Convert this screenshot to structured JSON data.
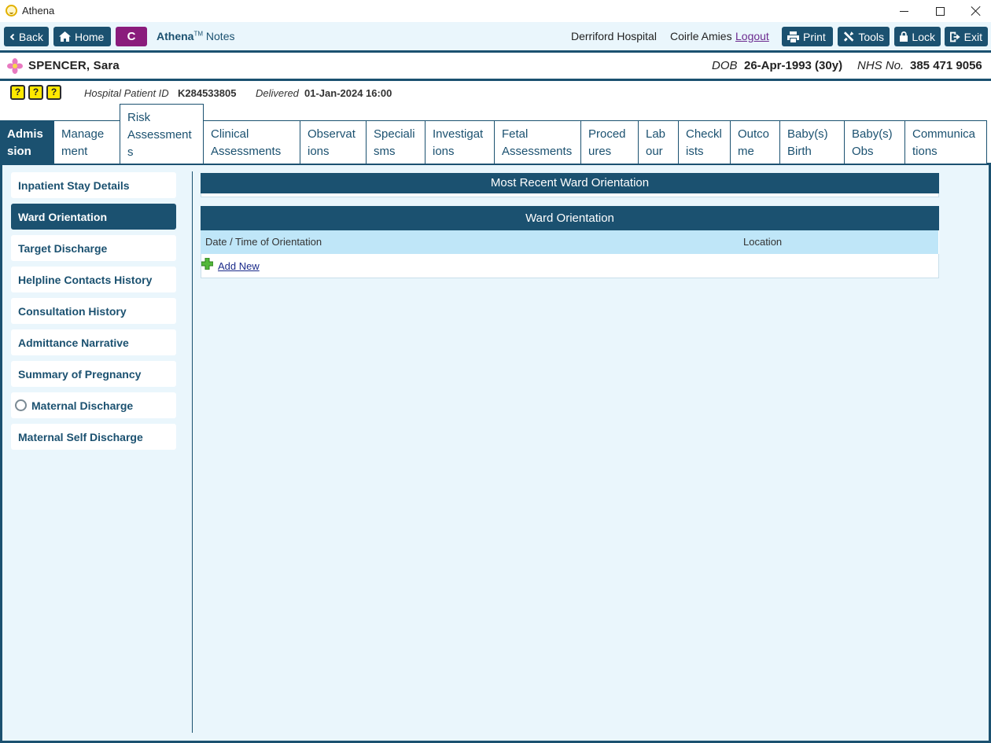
{
  "window": {
    "title": "Athena",
    "icons": {
      "logo": "athena-logo-icon",
      "minimize": "minimize-icon",
      "maximize": "maximize-icon",
      "close": "close-icon"
    }
  },
  "toolbar": {
    "back_label": "Back",
    "home_label": "Home",
    "c_label": "C",
    "brand_name": "Athena",
    "brand_tm": "TM",
    "brand_suffix": "Notes",
    "hospital": "Derriford Hospital",
    "user": "Coirle Amies",
    "logout_label": "Logout",
    "print_label": "Print",
    "tools_label": "Tools",
    "lock_label": "Lock",
    "exit_label": "Exit"
  },
  "patient": {
    "name": "SPENCER, Sara",
    "dob_label": "DOB",
    "dob_value": "26-Apr-1993 (30y)",
    "nhs_label": "NHS No.",
    "nhs_value": "385 471 9056",
    "hospital_id_label": "Hospital Patient ID",
    "hospital_id_value": "K284533805",
    "delivered_label": "Delivered",
    "delivered_value": "01-Jan-2024 16:00",
    "alert_icons": [
      "?",
      "?",
      "?"
    ]
  },
  "tabs": [
    {
      "line1": "Admis",
      "line2": "sion",
      "line3": ""
    },
    {
      "line1": "Manage",
      "line2": "ment",
      "line3": ""
    },
    {
      "line1": "Risk",
      "line2": "Assessment",
      "line3": "s"
    },
    {
      "line1": "Clinical",
      "line2": "Assessments",
      "line3": ""
    },
    {
      "line1": "Observat",
      "line2": "ions",
      "line3": ""
    },
    {
      "line1": "Speciali",
      "line2": "sms",
      "line3": ""
    },
    {
      "line1": "Investigat",
      "line2": "ions",
      "line3": ""
    },
    {
      "line1": "Fetal",
      "line2": "Assessments",
      "line3": ""
    },
    {
      "line1": "Proced",
      "line2": "ures",
      "line3": ""
    },
    {
      "line1": "Lab",
      "line2": "our",
      "line3": ""
    },
    {
      "line1": "Checkl",
      "line2": "ists",
      "line3": ""
    },
    {
      "line1": "Outco",
      "line2": "me",
      "line3": ""
    },
    {
      "line1": "Baby(s)",
      "line2": "Birth",
      "line3": ""
    },
    {
      "line1": "Baby(s)",
      "line2": "Obs",
      "line3": ""
    },
    {
      "line1": "Communica",
      "line2": "tions",
      "line3": ""
    }
  ],
  "sidebar": {
    "items": [
      {
        "label": "Inpatient Stay Details"
      },
      {
        "label": "Ward Orientation"
      },
      {
        "label": "Target Discharge"
      },
      {
        "label": "Helpline Contacts History"
      },
      {
        "label": "Consultation History"
      },
      {
        "label": "Admittance Narrative"
      },
      {
        "label": "Summary of Pregnancy"
      },
      {
        "label": "Maternal Discharge"
      },
      {
        "label": "Maternal Self Discharge"
      }
    ]
  },
  "main": {
    "recent_title": "Most Recent Ward Orientation",
    "table_title": "Ward Orientation",
    "columns": [
      "Date / Time of Orientation",
      "Location"
    ],
    "add_new_label": "Add New"
  },
  "colors": {
    "primary": "#1b5170",
    "accent": "#8a1c7c",
    "panel_bg": "#eaf6fc",
    "header_cell": "#bfe6f8"
  }
}
